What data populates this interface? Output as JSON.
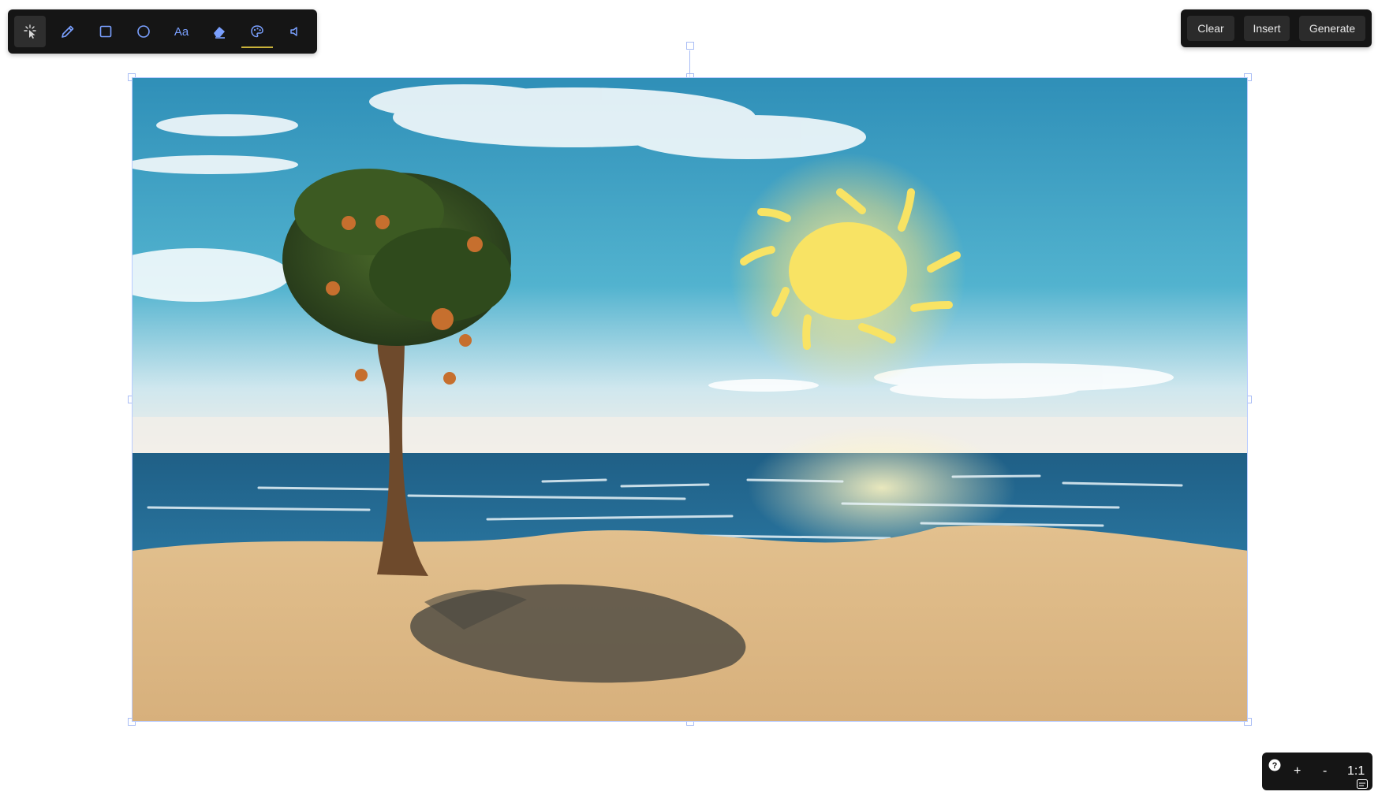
{
  "toolbar": {
    "tools": [
      {
        "name": "select",
        "icon": "magic-cursor-icon",
        "active": true
      },
      {
        "name": "pencil",
        "icon": "pencil-icon"
      },
      {
        "name": "rectangle",
        "icon": "rectangle-icon"
      },
      {
        "name": "ellipse",
        "icon": "circle-icon"
      },
      {
        "name": "text",
        "icon": "text-icon",
        "label": "Aa"
      },
      {
        "name": "eraser",
        "icon": "eraser-icon"
      },
      {
        "name": "color",
        "icon": "palette-icon",
        "underline_color": "#c9b23a"
      },
      {
        "name": "audio",
        "icon": "speaker-icon"
      }
    ],
    "icon_color": "#7aa0ff"
  },
  "actions": {
    "clear_label": "Clear",
    "insert_label": "Insert",
    "generate_label": "Generate"
  },
  "canvas": {
    "image_description_icon": "beach-image",
    "selection_color": "#a9bdf5"
  },
  "zoom": {
    "help_icon": "help-icon",
    "zoom_in_label": "+",
    "zoom_out_label": "-",
    "reset_label": "1:1",
    "caption_icon": "caption-icon"
  }
}
